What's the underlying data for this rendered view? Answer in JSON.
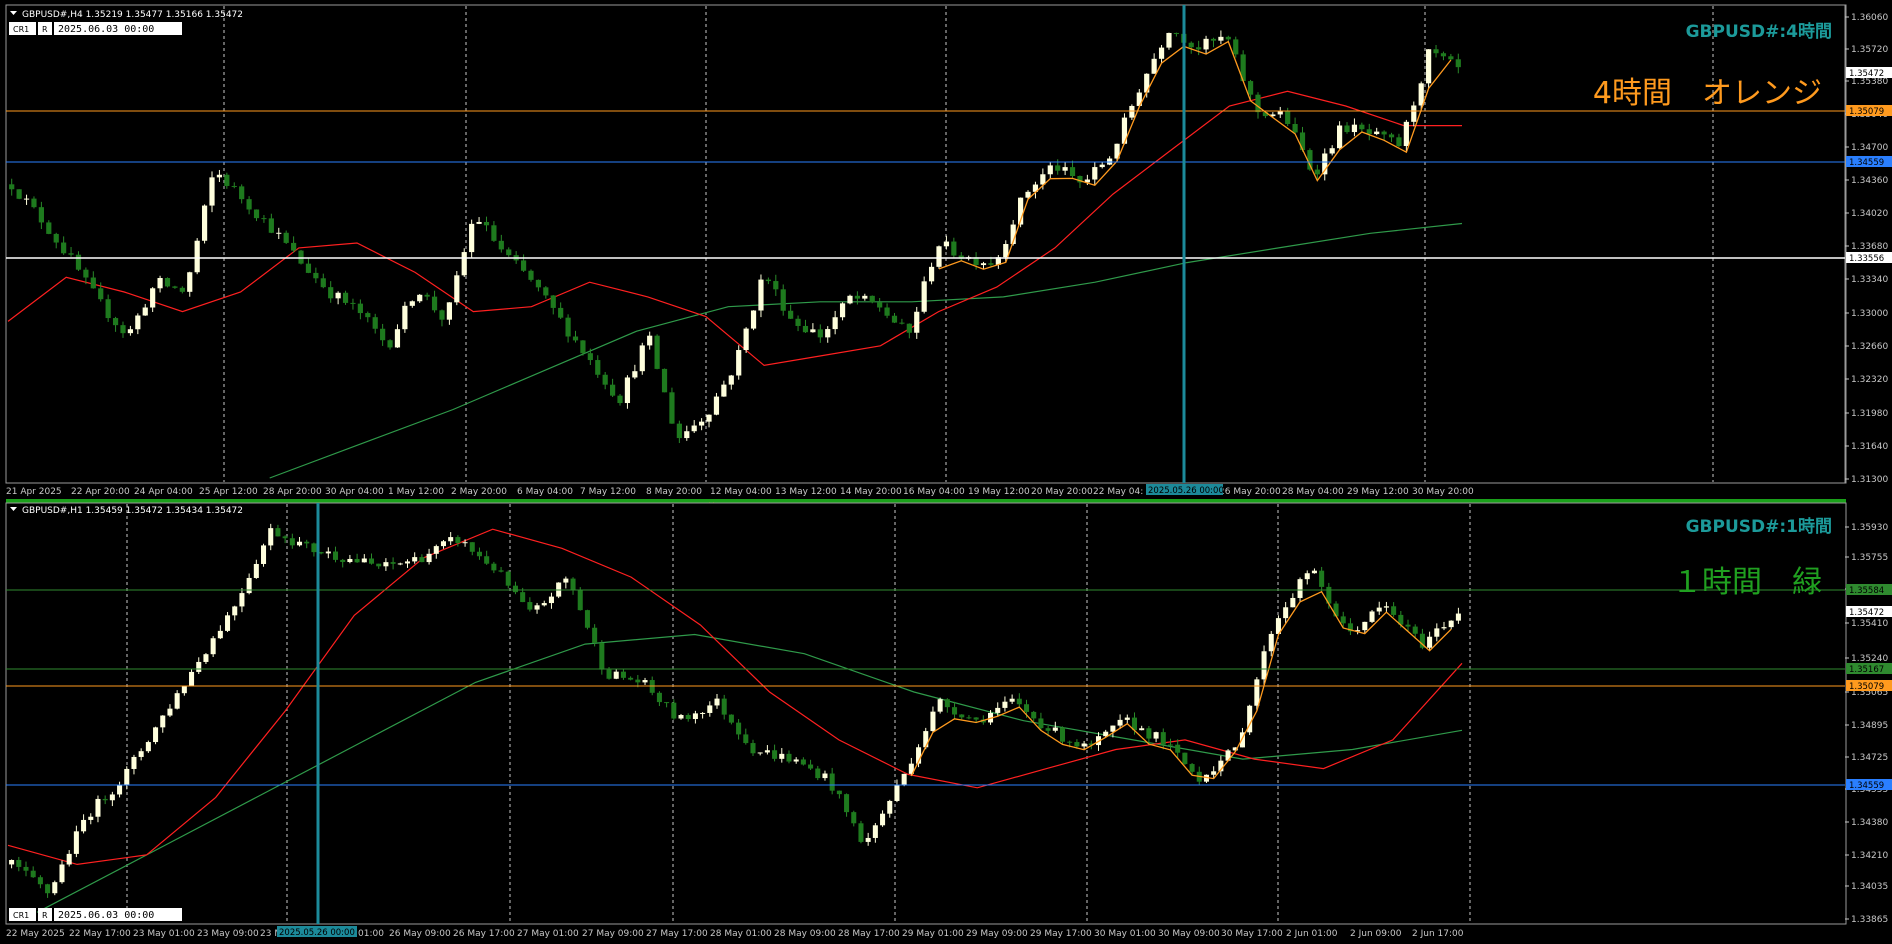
{
  "colors": {
    "background": "#000000",
    "bull_candle": "#ffffdd",
    "bear_candle": "#1e7a1e",
    "ma_fast": "#ff2020",
    "ma_slow": "#2f9a4a",
    "zigzag": "#ff9a1e",
    "line_orange": "#ff9a1e",
    "line_blue": "#2a7fff",
    "line_white": "#ffffff",
    "line_green": "#2f8a2f",
    "cursor_line": "#1c8a9a",
    "title_top": "#1c9a9a",
    "title_bottom": "#1c9a9a",
    "annotation_top": "#ff9a1e",
    "annotation_bottom": "#20a020"
  },
  "top_chart": {
    "header": "GBPUSD#,H4  1.35219 1.35477 1.35166 1.35472",
    "title": "GBPUSD#:4時間",
    "annotation": "4時間　オレンジ",
    "badges": [
      "CR1",
      "R"
    ],
    "datetime_field": "2025.06.03 00:00",
    "cursor_time_label": "2025.05.26 00:00",
    "y_ticks": [
      "1.36060",
      "1.35720",
      "1.35380",
      "1.35040",
      "1.34700",
      "1.34360",
      "1.34020",
      "1.33680",
      "1.33340",
      "1.33000",
      "1.32660",
      "1.32320",
      "1.31980",
      "1.31640",
      "1.31300"
    ],
    "x_labels": [
      "21 Apr 2025",
      "22 Apr 20:00",
      "24 Apr 04:00",
      "25 Apr 12:00",
      "28 Apr 20:00",
      "30 Apr 04:00",
      "1 May 12:00",
      "2 May 20:00",
      "6 May 04:00",
      "7 May 12:00",
      "8 May 20:00",
      "12 May 04:00",
      "13 May 12:00",
      "14 May 20:00",
      "16 May 04:00",
      "19 May 12:00",
      "20 May 20:00",
      "22 May 04:",
      "26 May 20:00",
      "28 May 04:00",
      "29 May 12:00",
      "30 May 20:00"
    ],
    "level_tags": [
      {
        "value": "1.35472",
        "kind": "price"
      },
      {
        "value": "1.35079",
        "kind": "orange"
      },
      {
        "value": "1.34559",
        "kind": "blue"
      },
      {
        "value": "1.33556",
        "kind": "white"
      }
    ],
    "ylim": [
      1.313,
      1.3606
    ]
  },
  "bottom_chart": {
    "header": "GBPUSD#,H1  1.35459 1.35472 1.35434 1.35472",
    "title": "GBPUSD#:1時間",
    "annotation": "１時間　緑",
    "badges": [
      "CR1",
      "R"
    ],
    "datetime_field": "2025.06.03 00:00",
    "cursor_time_label": "2025.05.26 00:00",
    "y_ticks": [
      "1.35930",
      "1.35755",
      "1.35585",
      "1.35410",
      "1.35240",
      "1.35065",
      "1.34895",
      "1.34725",
      "1.34555",
      "1.34380",
      "1.34210",
      "1.34035",
      "1.33865"
    ],
    "x_labels": [
      "22 May 2025",
      "22 May 17:00",
      "23 May 01:00",
      "23 May 09:00",
      "23 M",
      "01:00",
      "26 May 09:00",
      "26 May 17:00",
      "27 May 01:00",
      "27 May 09:00",
      "27 May 17:00",
      "28 May 01:00",
      "28 May 09:00",
      "28 May 17:00",
      "29 May 01:00",
      "29 May 09:00",
      "29 May 17:00",
      "30 May 01:00",
      "30 May 09:00",
      "30 May 17:00",
      "2 Jun 01:00",
      "2 Jun 09:00",
      "2 Jun 17:00"
    ],
    "level_tags": [
      {
        "value": "1.35584",
        "kind": "green"
      },
      {
        "value": "1.35472",
        "kind": "price"
      },
      {
        "value": "1.35167",
        "kind": "green"
      },
      {
        "value": "1.35079",
        "kind": "orange"
      },
      {
        "value": "1.34559",
        "kind": "blue"
      }
    ],
    "ylim": [
      1.3386,
      1.36
    ]
  },
  "chart_data": [
    {
      "type": "candlestick",
      "title": "GBPUSD#:4時間",
      "timeframe": "H4",
      "ylim": [
        1.313,
        1.3606
      ],
      "horizontal_levels": [
        {
          "value": 1.35079,
          "color": "orange"
        },
        {
          "value": 1.34559,
          "color": "blue"
        },
        {
          "value": 1.33556,
          "color": "white"
        }
      ],
      "series": [
        {
          "name": "MA fast",
          "y_approx": [
            1.329,
            1.3335,
            1.332,
            1.33,
            1.332,
            1.3365,
            1.337,
            1.334,
            1.33,
            1.3305,
            1.333,
            1.3315,
            1.3295,
            1.3245,
            1.3255,
            1.3265,
            1.33,
            1.3325,
            1.3365,
            1.342,
            1.3465,
            1.351,
            1.3525,
            1.351,
            1.349,
            1.349
          ]
        },
        {
          "name": "MA slow",
          "y_approx": [
            1.313,
            1.3165,
            1.32,
            1.324,
            1.328,
            1.3305,
            1.331,
            1.331,
            1.3315,
            1.333,
            1.335,
            1.3365,
            1.338,
            1.339
          ]
        }
      ],
      "price_path_approx": [
        1.343,
        1.3395,
        1.3355,
        1.331,
        1.3275,
        1.333,
        1.332,
        1.3445,
        1.3415,
        1.3385,
        1.335,
        1.332,
        1.33,
        1.3265,
        1.3325,
        1.329,
        1.34,
        1.336,
        1.333,
        1.329,
        1.325,
        1.321,
        1.3275,
        1.317,
        1.3195,
        1.3245,
        1.334,
        1.329,
        1.3275,
        1.3315,
        1.3305,
        1.3275,
        1.337,
        1.3355,
        1.335,
        1.342,
        1.345,
        1.343,
        1.346,
        1.353,
        1.359,
        1.357,
        1.358,
        1.3505,
        1.35,
        1.344,
        1.349,
        1.348,
        1.347,
        1.3565,
        1.3547
      ]
    },
    {
      "type": "candlestick",
      "title": "GBPUSD#:1時間",
      "timeframe": "H1",
      "ylim": [
        1.3386,
        1.36
      ],
      "horizontal_levels": [
        {
          "value": 1.35584,
          "color": "green"
        },
        {
          "value": 1.35167,
          "color": "green"
        },
        {
          "value": 1.35079,
          "color": "orange"
        },
        {
          "value": 1.34559,
          "color": "blue"
        }
      ],
      "series": [
        {
          "name": "MA fast",
          "y_approx": [
            1.3425,
            1.3415,
            1.342,
            1.345,
            1.3495,
            1.3545,
            1.3575,
            1.359,
            1.358,
            1.3565,
            1.354,
            1.3505,
            1.348,
            1.3462,
            1.3455,
            1.3465,
            1.3475,
            1.348,
            1.347,
            1.3465,
            1.348,
            1.352
          ]
        },
        {
          "name": "MA slow",
          "y_approx": [
            1.339,
            1.342,
            1.345,
            1.348,
            1.351,
            1.353,
            1.3535,
            1.3525,
            1.3505,
            1.349,
            1.348,
            1.347,
            1.3475,
            1.3485
          ]
        }
      ],
      "price_path_approx": [
        1.3415,
        1.34,
        1.344,
        1.346,
        1.349,
        1.352,
        1.355,
        1.359,
        1.358,
        1.3575,
        1.357,
        1.3575,
        1.3585,
        1.357,
        1.3545,
        1.3565,
        1.3515,
        1.351,
        1.349,
        1.35,
        1.3475,
        1.347,
        1.346,
        1.3425,
        1.346,
        1.35,
        1.349,
        1.35,
        1.3485,
        1.3475,
        1.349,
        1.348,
        1.346,
        1.3475,
        1.354,
        1.357,
        1.3535,
        1.355,
        1.353,
        1.3547
      ]
    }
  ]
}
